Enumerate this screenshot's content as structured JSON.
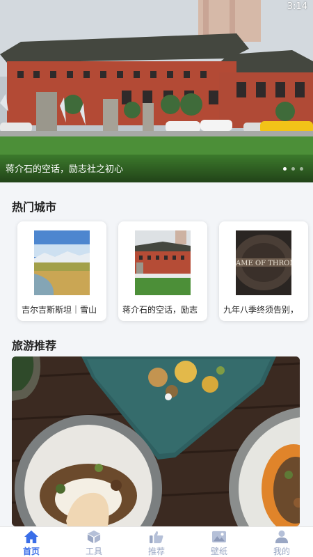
{
  "status": {
    "time": "3:14"
  },
  "banner": {
    "caption": "蒋介石的空话，励志社之初心",
    "slides": 3,
    "active_slide": 1
  },
  "hot_cities": {
    "title": "热门城市",
    "items": [
      {
        "label": "吉尔吉斯斯坦｜雪山"
      },
      {
        "label": "蒋介石的空话，励志"
      },
      {
        "label": "九年八季终须告别，"
      }
    ]
  },
  "travel": {
    "title": "旅游推荐"
  },
  "tabbar": {
    "items": [
      {
        "label": "首页",
        "icon": "home-icon",
        "active": true
      },
      {
        "label": "工具",
        "icon": "cube-icon",
        "active": false
      },
      {
        "label": "推荐",
        "icon": "thumbs-up-icon",
        "active": false
      },
      {
        "label": "壁纸",
        "icon": "image-icon",
        "active": false
      },
      {
        "label": "我的",
        "icon": "user-icon",
        "active": false
      }
    ]
  },
  "colors": {
    "accent": "#3a6ee8",
    "inactive": "#9aa7c4"
  }
}
